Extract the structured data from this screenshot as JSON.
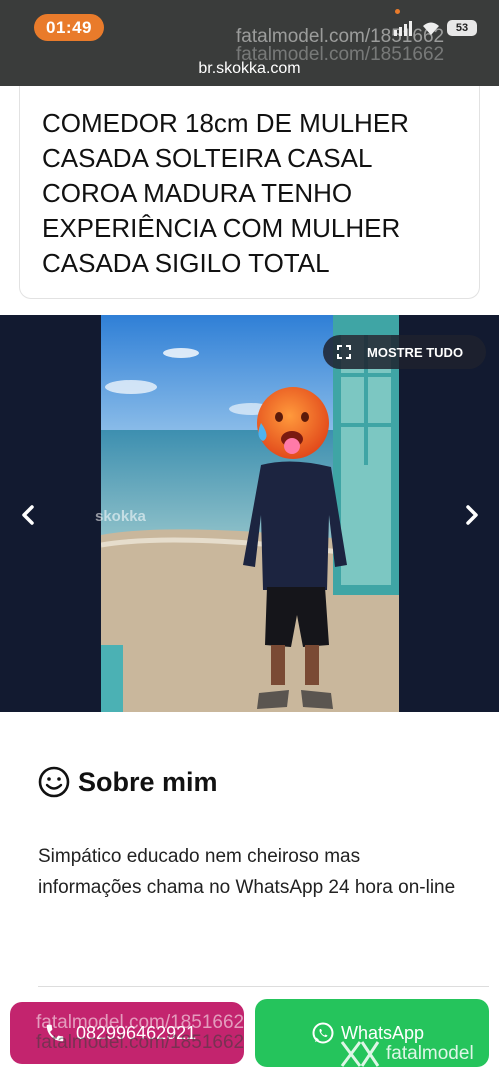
{
  "status_bar": {
    "time": "01:49",
    "battery": "53",
    "url": "br.skokka.com",
    "watermark": "fatalmodel.com/1851662"
  },
  "listing": {
    "title": "COMEDOR 18cm DE MULHER CASADA SOLTEIRA CASAL COROA MADURA TENHO EXPERIÊNCIA COM MULHER CASADA SIGILO TOTAL"
  },
  "gallery": {
    "show_all_label": "MOSTRE TUDO",
    "watermark": "skokka",
    "icons": [
      "expand-icon",
      "chevron-left-icon",
      "chevron-right-icon"
    ]
  },
  "about": {
    "heading": "Sobre mim",
    "text": "Simpático educado nem cheiroso mas informações chama no WhatsApp 24 hora on-line"
  },
  "actions": {
    "phone_number": "082996462921",
    "whatsapp_label": "WhatsApp",
    "phone_color": "#c3246e",
    "whatsapp_color": "#25c45c"
  },
  "overlay": {
    "watermark": "fatalmodel.com/1851662",
    "logo": "fatalmodel"
  }
}
